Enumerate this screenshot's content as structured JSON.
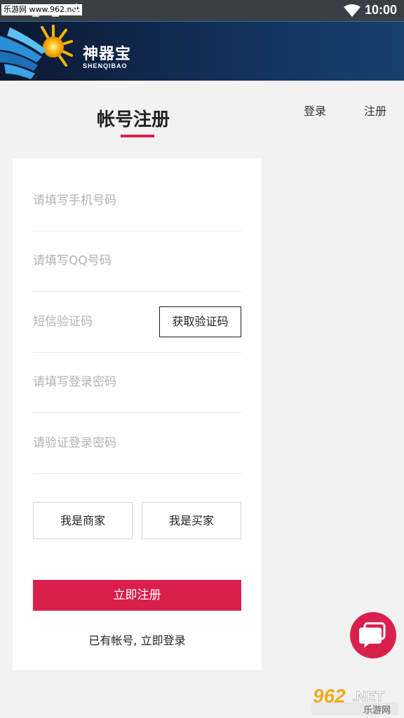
{
  "status_bar": {
    "watermark": "乐游网 www.962.net",
    "time": "10:00"
  },
  "header": {
    "brand_cn": "神器宝",
    "brand_en": "SHENQIBAO"
  },
  "nav": {
    "login": "登录",
    "register": "注册"
  },
  "page": {
    "title": "帐号注册"
  },
  "form": {
    "phone_placeholder": "请填写手机号码",
    "qq_placeholder": "请填写QQ号码",
    "sms_placeholder": "短信验证码",
    "get_code_label": "获取验证码",
    "password_placeholder": "请填写登录密码",
    "confirm_password_placeholder": "请验证登录密码",
    "role_merchant": "我是商家",
    "role_buyer": "我是买家",
    "submit_label": "立即注册",
    "login_prompt": "已有帐号, 立即登录"
  },
  "watermark_bottom": {
    "number": "962",
    "suffix": ".NET",
    "cn": "乐游网"
  },
  "colors": {
    "accent": "#d9204d",
    "header_bg": "#12305a",
    "status_bg": "#3a3f45"
  }
}
